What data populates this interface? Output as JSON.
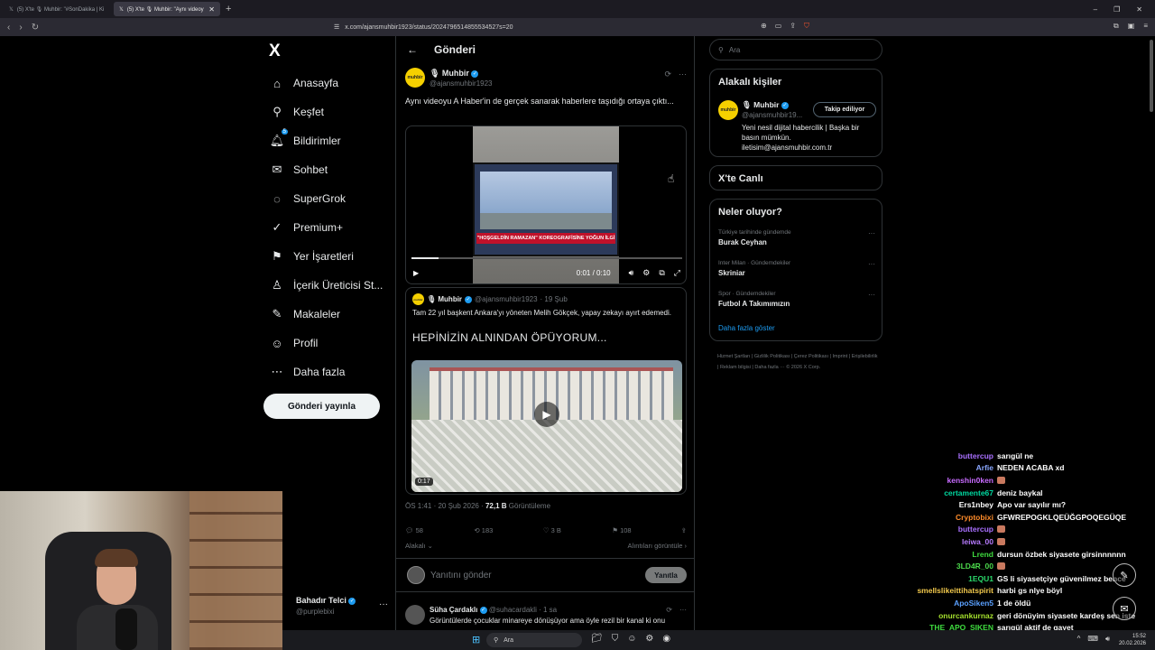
{
  "browser": {
    "tabs": [
      {
        "label": "(5) X'te 🎙 Muhbir: \"#SonDakika | Ki",
        "active": false
      },
      {
        "label": "(5) X'te 🎙 Muhbir: \"Aynı videoy",
        "active": true
      }
    ],
    "url": "x.com/ajansmuhbir1923/status/2024796514855534527s=20",
    "win_controls": [
      "–",
      "❐",
      "✕"
    ]
  },
  "leftnav": {
    "logo": "X",
    "items": [
      {
        "label": "Anasayfa",
        "icon": "home-icon",
        "glyph": "⌂"
      },
      {
        "label": "Keşfet",
        "icon": "search-icon",
        "glyph": "⚲"
      },
      {
        "label": "Bildirimler",
        "icon": "bell-icon",
        "glyph": "♫",
        "badge": "5"
      },
      {
        "label": "Sohbet",
        "icon": "mail-icon",
        "glyph": "✉"
      },
      {
        "label": "SuperGrok",
        "icon": "grok-icon",
        "glyph": "◌"
      },
      {
        "label": "Premium+",
        "icon": "premium-icon",
        "glyph": "✓"
      },
      {
        "label": "Yer İşaretleri",
        "icon": "bookmark-icon",
        "glyph": "⚑"
      },
      {
        "label": "İçerik Üreticisi St...",
        "icon": "creator-studio-icon",
        "glyph": "♙"
      },
      {
        "label": "Makaleler",
        "icon": "articles-icon",
        "glyph": "✎"
      },
      {
        "label": "Profil",
        "icon": "profile-icon",
        "glyph": "☺"
      },
      {
        "label": "Daha fazla",
        "icon": "more-icon",
        "glyph": "⋯"
      }
    ],
    "post_button": "Gönderi yayınla",
    "account": {
      "name": "Bahadır Telci",
      "handle": "@purplebixi",
      "more": "···"
    }
  },
  "center": {
    "header": {
      "back": "←",
      "title": "Gönderi"
    },
    "tweet": {
      "avatar": "muhbir",
      "name": "🎙 Muhbir",
      "handle": "@ajansmuhbir1923",
      "text": "Aynı videoyu A Haber'in de gerçek sanarak haberlere taşıdığı ortaya çıktı...",
      "video": {
        "banner": "\"HOŞGELDİN RAMAZAN\" KOREOGRAFİSİNE YOĞUN İLGİ",
        "time": "0:01 / 0:10",
        "progress": 0.1
      },
      "quote": {
        "name": "🎙 Muhbir",
        "handle": "@ajansmuhbir1923",
        "date": "· 19 Şub",
        "text": "Tam 22 yıl başkent Ankara'yı yöneten Melih Gökçek, yapay zekayı ayırt edemedi.",
        "big_text": "HEPİNİZİN ALNINDAN ÖPÜYORUM...",
        "duration": "0:17"
      },
      "meta": {
        "time": "ÖS 1:41 · 20 Şub 2026 ·",
        "views": "72,1 B",
        "views_label": "Görüntüleme"
      },
      "engagement": {
        "replies": "58",
        "reposts": "183",
        "likes": "3 B",
        "bookmarks": "108"
      },
      "related": "Alakalı",
      "quotes_link": "Alıntıları görüntüle"
    },
    "reply_box": {
      "placeholder": "Yanıtını gönder",
      "button": "Yanıtla"
    },
    "reply": {
      "name": "Süha Çardaklı",
      "handle": "@suhacardakli",
      "time": "· 1 sa",
      "text": "Görüntülerde çocuklar minareye dönüşüyor ama öyle rezil bir kanal ki onu"
    }
  },
  "right": {
    "search_placeholder": "Ara",
    "related_people": {
      "title": "Alakalı kişiler",
      "name": "🎙 Muhbir",
      "handle": "@ajansmuhbir19...",
      "follow": "Takip ediliyor",
      "bio": "Yeni nesil dijital habercilik | Başka bir basın mümkün. iletisim@ajansmuhbir.com.tr"
    },
    "live": {
      "title": "X'te Canlı"
    },
    "trends": {
      "title": "Neler oluyor?",
      "items": [
        {
          "context": "Türkiye tarihinde gündemde",
          "topic": "Burak Ceyhan"
        },
        {
          "context": "Inter Milan · Gündemdekiler",
          "topic": "Skriniar"
        },
        {
          "context": "Spor · Gündemdekiler",
          "topic": "Futbol A Takımımızın"
        }
      ],
      "show_more": "Daha fazla göster"
    },
    "footer": "Hizmet Şartları  |  Gizlilik Politikası  |  Çerez Politikası  |  Imprint  |  Erişilebilirlik  |  Reklam bilgisi  |  Daha fazla ···  © 2026 X Corp."
  },
  "chat": [
    {
      "user": "buttercup",
      "color": "#a970ff",
      "msg": "sarıgül ne"
    },
    {
      "user": "Arfie",
      "color": "#8aa7ff",
      "msg": "NEDEN ACABA xd"
    },
    {
      "user": "kenshin0ken",
      "color": "#c86bff",
      "msg": ""
    },
    {
      "user": "certamente67",
      "color": "#00d8a0",
      "msg": "deniz baykal"
    },
    {
      "user": "Ers1nbey",
      "color": "#ffffff",
      "msg": "Apo var sayılır mı?"
    },
    {
      "user": "Cryptobixi",
      "color": "#ff8c2a",
      "msg": "GFWREPOGKLQEÜĞGPOQEGÜQE"
    },
    {
      "user": "buttercup",
      "color": "#a970ff",
      "msg": ""
    },
    {
      "user": "leiwa_00",
      "color": "#b77bff",
      "msg": ""
    },
    {
      "user": "Lrend",
      "color": "#3fdc3f",
      "msg": "dursun özbek siyasete girsinnnnnn"
    },
    {
      "user": "3LD4R_00",
      "color": "#4cd94c",
      "msg": ""
    },
    {
      "user": "1EQU1",
      "color": "#2bd96b",
      "msg": "GS li siyasetçiye güvenilmez bence"
    },
    {
      "user": "smellslikeittihatspirit",
      "color": "#f2c94c",
      "msg": "harbi gs nlye böyl"
    },
    {
      "user": "ApoSiken5",
      "color": "#5aa0ff",
      "msg": "1 de öldü"
    },
    {
      "user": "onurcankurnaz",
      "color": "#a6e22e",
      "msg": "geri dönüyim siyasete kardeş sen iste"
    },
    {
      "user": "THE_APO_SIKEN",
      "color": "#3fdc3f",
      "msg": "sarıgül aktif de gayet"
    }
  ],
  "taskbar": {
    "search": "Ara",
    "clock_time": "15:52",
    "clock_date": "20.02.2026"
  }
}
